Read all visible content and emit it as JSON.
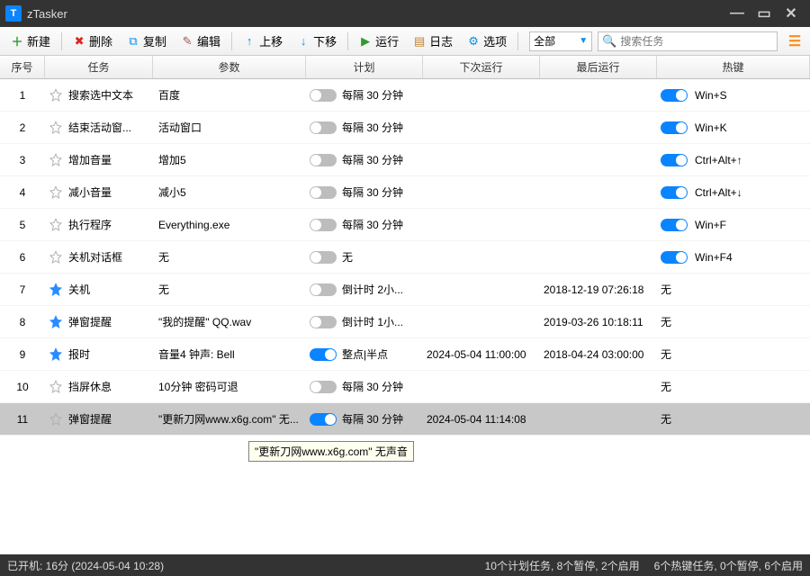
{
  "window": {
    "title": "zTasker"
  },
  "toolbar": {
    "new": "新建",
    "delete": "删除",
    "copy": "复制",
    "edit": "编辑",
    "moveup": "上移",
    "movedown": "下移",
    "run": "运行",
    "log": "日志",
    "options": "选项"
  },
  "filter": {
    "selected": "全部"
  },
  "search": {
    "placeholder": "搜索任务"
  },
  "columns": {
    "num": "序号",
    "task": "任务",
    "param": "参数",
    "plan": "计划",
    "next": "下次运行",
    "last": "最后运行",
    "hotkey": "热键"
  },
  "rows": [
    {
      "num": "1",
      "fav": false,
      "task": "搜索选中文本",
      "param": "百度",
      "plan_on": false,
      "plan": "每隔 30 分钟",
      "next": "",
      "last": "",
      "hk_on": true,
      "hotkey": "Win+S"
    },
    {
      "num": "2",
      "fav": false,
      "task": "结束活动窗...",
      "param": "活动窗口",
      "plan_on": false,
      "plan": "每隔 30 分钟",
      "next": "",
      "last": "",
      "hk_on": true,
      "hotkey": "Win+K"
    },
    {
      "num": "3",
      "fav": false,
      "task": "增加音量",
      "param": "增加5",
      "plan_on": false,
      "plan": "每隔 30 分钟",
      "next": "",
      "last": "",
      "hk_on": true,
      "hotkey": "Ctrl+Alt+↑"
    },
    {
      "num": "4",
      "fav": false,
      "task": "减小音量",
      "param": "减小5",
      "plan_on": false,
      "plan": "每隔 30 分钟",
      "next": "",
      "last": "",
      "hk_on": true,
      "hotkey": "Ctrl+Alt+↓"
    },
    {
      "num": "5",
      "fav": false,
      "task": "执行程序",
      "param": "Everything.exe",
      "plan_on": false,
      "plan": "每隔 30 分钟",
      "next": "",
      "last": "",
      "hk_on": true,
      "hotkey": "Win+F"
    },
    {
      "num": "6",
      "fav": false,
      "task": "关机对话框",
      "param": "无",
      "plan_on": false,
      "plan": "无",
      "next": "",
      "last": "",
      "hk_on": true,
      "hotkey": "Win+F4"
    },
    {
      "num": "7",
      "fav": true,
      "task": "关机",
      "param": "无",
      "plan_on": false,
      "plan": "倒计时 2小...",
      "next": "",
      "last": "2018-12-19 07:26:18",
      "hk_on": false,
      "hotkey": "无"
    },
    {
      "num": "8",
      "fav": true,
      "task": "弹窗提醒",
      "param": "\"我的提醒\" QQ.wav",
      "plan_on": false,
      "plan": "倒计时 1小...",
      "next": "",
      "last": "2019-03-26 10:18:11",
      "hk_on": false,
      "hotkey": "无"
    },
    {
      "num": "9",
      "fav": true,
      "task": "报时",
      "param": "音量4 钟声: Bell",
      "plan_on": true,
      "plan": "整点|半点",
      "next": "2024-05-04 11:00:00",
      "last": "2018-04-24 03:00:00",
      "hk_on": false,
      "hotkey": "无"
    },
    {
      "num": "10",
      "fav": false,
      "task": "挡屏休息",
      "param": "10分钟 密码可退",
      "plan_on": false,
      "plan": "每隔 30 分钟",
      "next": "",
      "last": "",
      "hk_on": false,
      "hotkey": "无"
    },
    {
      "num": "11",
      "fav": false,
      "task": "弹窗提醒",
      "param": "\"更新刀网www.x6g.com\" 无...",
      "plan_on": true,
      "plan": "每隔 30 分钟",
      "next": "2024-05-04 11:14:08",
      "last": "",
      "hk_on": false,
      "hotkey": "无",
      "selected": true
    }
  ],
  "tooltip": "\"更新刀网www.x6g.com\" 无声音",
  "status": {
    "left": "已开机:  16分 (2024-05-04 10:28)",
    "mid": "10个计划任务, 8个暂停, 2个启用",
    "right": "6个热键任务, 0个暂停, 6个启用"
  }
}
